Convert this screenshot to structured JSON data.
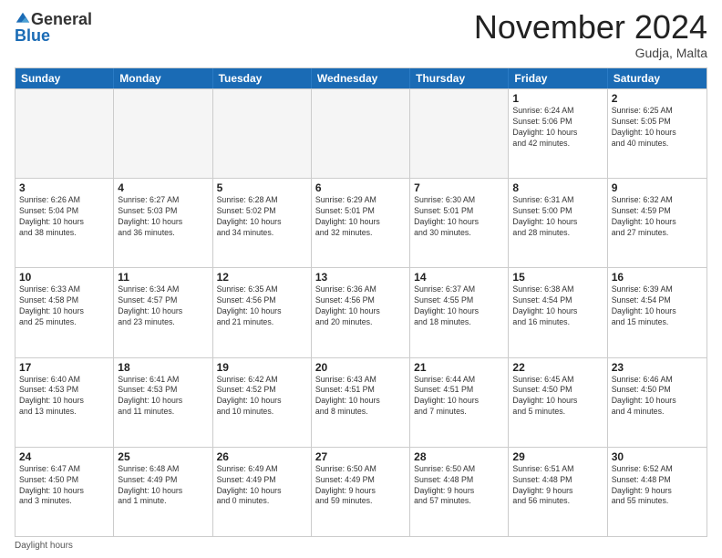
{
  "header": {
    "logo_general": "General",
    "logo_blue": "Blue",
    "month_title": "November 2024",
    "location": "Gudja, Malta"
  },
  "weekdays": [
    "Sunday",
    "Monday",
    "Tuesday",
    "Wednesday",
    "Thursday",
    "Friday",
    "Saturday"
  ],
  "weeks": [
    [
      {
        "day": "",
        "info": "",
        "empty": true
      },
      {
        "day": "",
        "info": "",
        "empty": true
      },
      {
        "day": "",
        "info": "",
        "empty": true
      },
      {
        "day": "",
        "info": "",
        "empty": true
      },
      {
        "day": "",
        "info": "",
        "empty": true
      },
      {
        "day": "1",
        "info": "Sunrise: 6:24 AM\nSunset: 5:06 PM\nDaylight: 10 hours\nand 42 minutes.",
        "empty": false
      },
      {
        "day": "2",
        "info": "Sunrise: 6:25 AM\nSunset: 5:05 PM\nDaylight: 10 hours\nand 40 minutes.",
        "empty": false
      }
    ],
    [
      {
        "day": "3",
        "info": "Sunrise: 6:26 AM\nSunset: 5:04 PM\nDaylight: 10 hours\nand 38 minutes.",
        "empty": false
      },
      {
        "day": "4",
        "info": "Sunrise: 6:27 AM\nSunset: 5:03 PM\nDaylight: 10 hours\nand 36 minutes.",
        "empty": false
      },
      {
        "day": "5",
        "info": "Sunrise: 6:28 AM\nSunset: 5:02 PM\nDaylight: 10 hours\nand 34 minutes.",
        "empty": false
      },
      {
        "day": "6",
        "info": "Sunrise: 6:29 AM\nSunset: 5:01 PM\nDaylight: 10 hours\nand 32 minutes.",
        "empty": false
      },
      {
        "day": "7",
        "info": "Sunrise: 6:30 AM\nSunset: 5:01 PM\nDaylight: 10 hours\nand 30 minutes.",
        "empty": false
      },
      {
        "day": "8",
        "info": "Sunrise: 6:31 AM\nSunset: 5:00 PM\nDaylight: 10 hours\nand 28 minutes.",
        "empty": false
      },
      {
        "day": "9",
        "info": "Sunrise: 6:32 AM\nSunset: 4:59 PM\nDaylight: 10 hours\nand 27 minutes.",
        "empty": false
      }
    ],
    [
      {
        "day": "10",
        "info": "Sunrise: 6:33 AM\nSunset: 4:58 PM\nDaylight: 10 hours\nand 25 minutes.",
        "empty": false
      },
      {
        "day": "11",
        "info": "Sunrise: 6:34 AM\nSunset: 4:57 PM\nDaylight: 10 hours\nand 23 minutes.",
        "empty": false
      },
      {
        "day": "12",
        "info": "Sunrise: 6:35 AM\nSunset: 4:56 PM\nDaylight: 10 hours\nand 21 minutes.",
        "empty": false
      },
      {
        "day": "13",
        "info": "Sunrise: 6:36 AM\nSunset: 4:56 PM\nDaylight: 10 hours\nand 20 minutes.",
        "empty": false
      },
      {
        "day": "14",
        "info": "Sunrise: 6:37 AM\nSunset: 4:55 PM\nDaylight: 10 hours\nand 18 minutes.",
        "empty": false
      },
      {
        "day": "15",
        "info": "Sunrise: 6:38 AM\nSunset: 4:54 PM\nDaylight: 10 hours\nand 16 minutes.",
        "empty": false
      },
      {
        "day": "16",
        "info": "Sunrise: 6:39 AM\nSunset: 4:54 PM\nDaylight: 10 hours\nand 15 minutes.",
        "empty": false
      }
    ],
    [
      {
        "day": "17",
        "info": "Sunrise: 6:40 AM\nSunset: 4:53 PM\nDaylight: 10 hours\nand 13 minutes.",
        "empty": false
      },
      {
        "day": "18",
        "info": "Sunrise: 6:41 AM\nSunset: 4:53 PM\nDaylight: 10 hours\nand 11 minutes.",
        "empty": false
      },
      {
        "day": "19",
        "info": "Sunrise: 6:42 AM\nSunset: 4:52 PM\nDaylight: 10 hours\nand 10 minutes.",
        "empty": false
      },
      {
        "day": "20",
        "info": "Sunrise: 6:43 AM\nSunset: 4:51 PM\nDaylight: 10 hours\nand 8 minutes.",
        "empty": false
      },
      {
        "day": "21",
        "info": "Sunrise: 6:44 AM\nSunset: 4:51 PM\nDaylight: 10 hours\nand 7 minutes.",
        "empty": false
      },
      {
        "day": "22",
        "info": "Sunrise: 6:45 AM\nSunset: 4:50 PM\nDaylight: 10 hours\nand 5 minutes.",
        "empty": false
      },
      {
        "day": "23",
        "info": "Sunrise: 6:46 AM\nSunset: 4:50 PM\nDaylight: 10 hours\nand 4 minutes.",
        "empty": false
      }
    ],
    [
      {
        "day": "24",
        "info": "Sunrise: 6:47 AM\nSunset: 4:50 PM\nDaylight: 10 hours\nand 3 minutes.",
        "empty": false
      },
      {
        "day": "25",
        "info": "Sunrise: 6:48 AM\nSunset: 4:49 PM\nDaylight: 10 hours\nand 1 minute.",
        "empty": false
      },
      {
        "day": "26",
        "info": "Sunrise: 6:49 AM\nSunset: 4:49 PM\nDaylight: 10 hours\nand 0 minutes.",
        "empty": false
      },
      {
        "day": "27",
        "info": "Sunrise: 6:50 AM\nSunset: 4:49 PM\nDaylight: 9 hours\nand 59 minutes.",
        "empty": false
      },
      {
        "day": "28",
        "info": "Sunrise: 6:50 AM\nSunset: 4:48 PM\nDaylight: 9 hours\nand 57 minutes.",
        "empty": false
      },
      {
        "day": "29",
        "info": "Sunrise: 6:51 AM\nSunset: 4:48 PM\nDaylight: 9 hours\nand 56 minutes.",
        "empty": false
      },
      {
        "day": "30",
        "info": "Sunrise: 6:52 AM\nSunset: 4:48 PM\nDaylight: 9 hours\nand 55 minutes.",
        "empty": false
      }
    ]
  ],
  "footer": {
    "daylight_label": "Daylight hours"
  }
}
